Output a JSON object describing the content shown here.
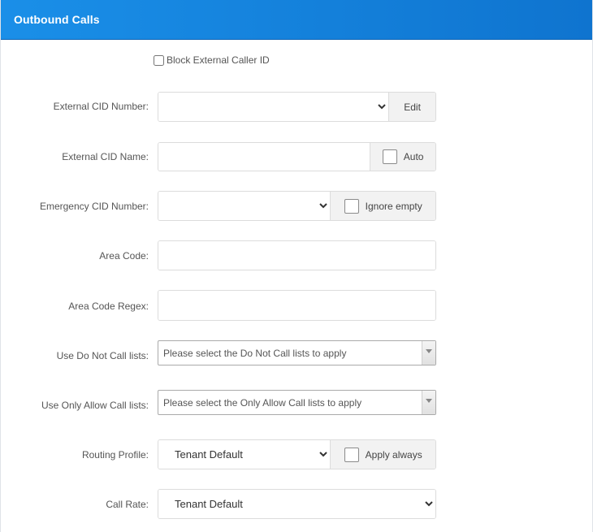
{
  "header": {
    "title": "Outbound Calls"
  },
  "block_external_caller_id": {
    "label": "Block External Caller ID",
    "checked": false
  },
  "external_cid_number": {
    "label": "External CID Number:",
    "value": "",
    "edit_label": "Edit"
  },
  "external_cid_name": {
    "label": "External CID Name:",
    "value": "",
    "auto_label": "Auto",
    "auto_checked": false
  },
  "emergency_cid_number": {
    "label": "Emergency CID Number:",
    "value": "",
    "ignore_empty_label": "Ignore empty",
    "ignore_empty_checked": false
  },
  "area_code": {
    "label": "Area Code:",
    "value": ""
  },
  "area_code_regex": {
    "label": "Area Code Regex:",
    "value": ""
  },
  "do_not_call_lists": {
    "label": "Use Do Not Call lists:",
    "placeholder": "Please select the Do Not Call lists to apply"
  },
  "only_allow_call_lists": {
    "label": "Use Only Allow Call lists:",
    "placeholder": "Please select the Only Allow Call lists to apply"
  },
  "routing_profile": {
    "label": "Routing Profile:",
    "value": "Tenant Default",
    "apply_always_label": "Apply always",
    "apply_always_checked": false
  },
  "call_rate": {
    "label": "Call Rate:",
    "value": "Tenant Default"
  }
}
